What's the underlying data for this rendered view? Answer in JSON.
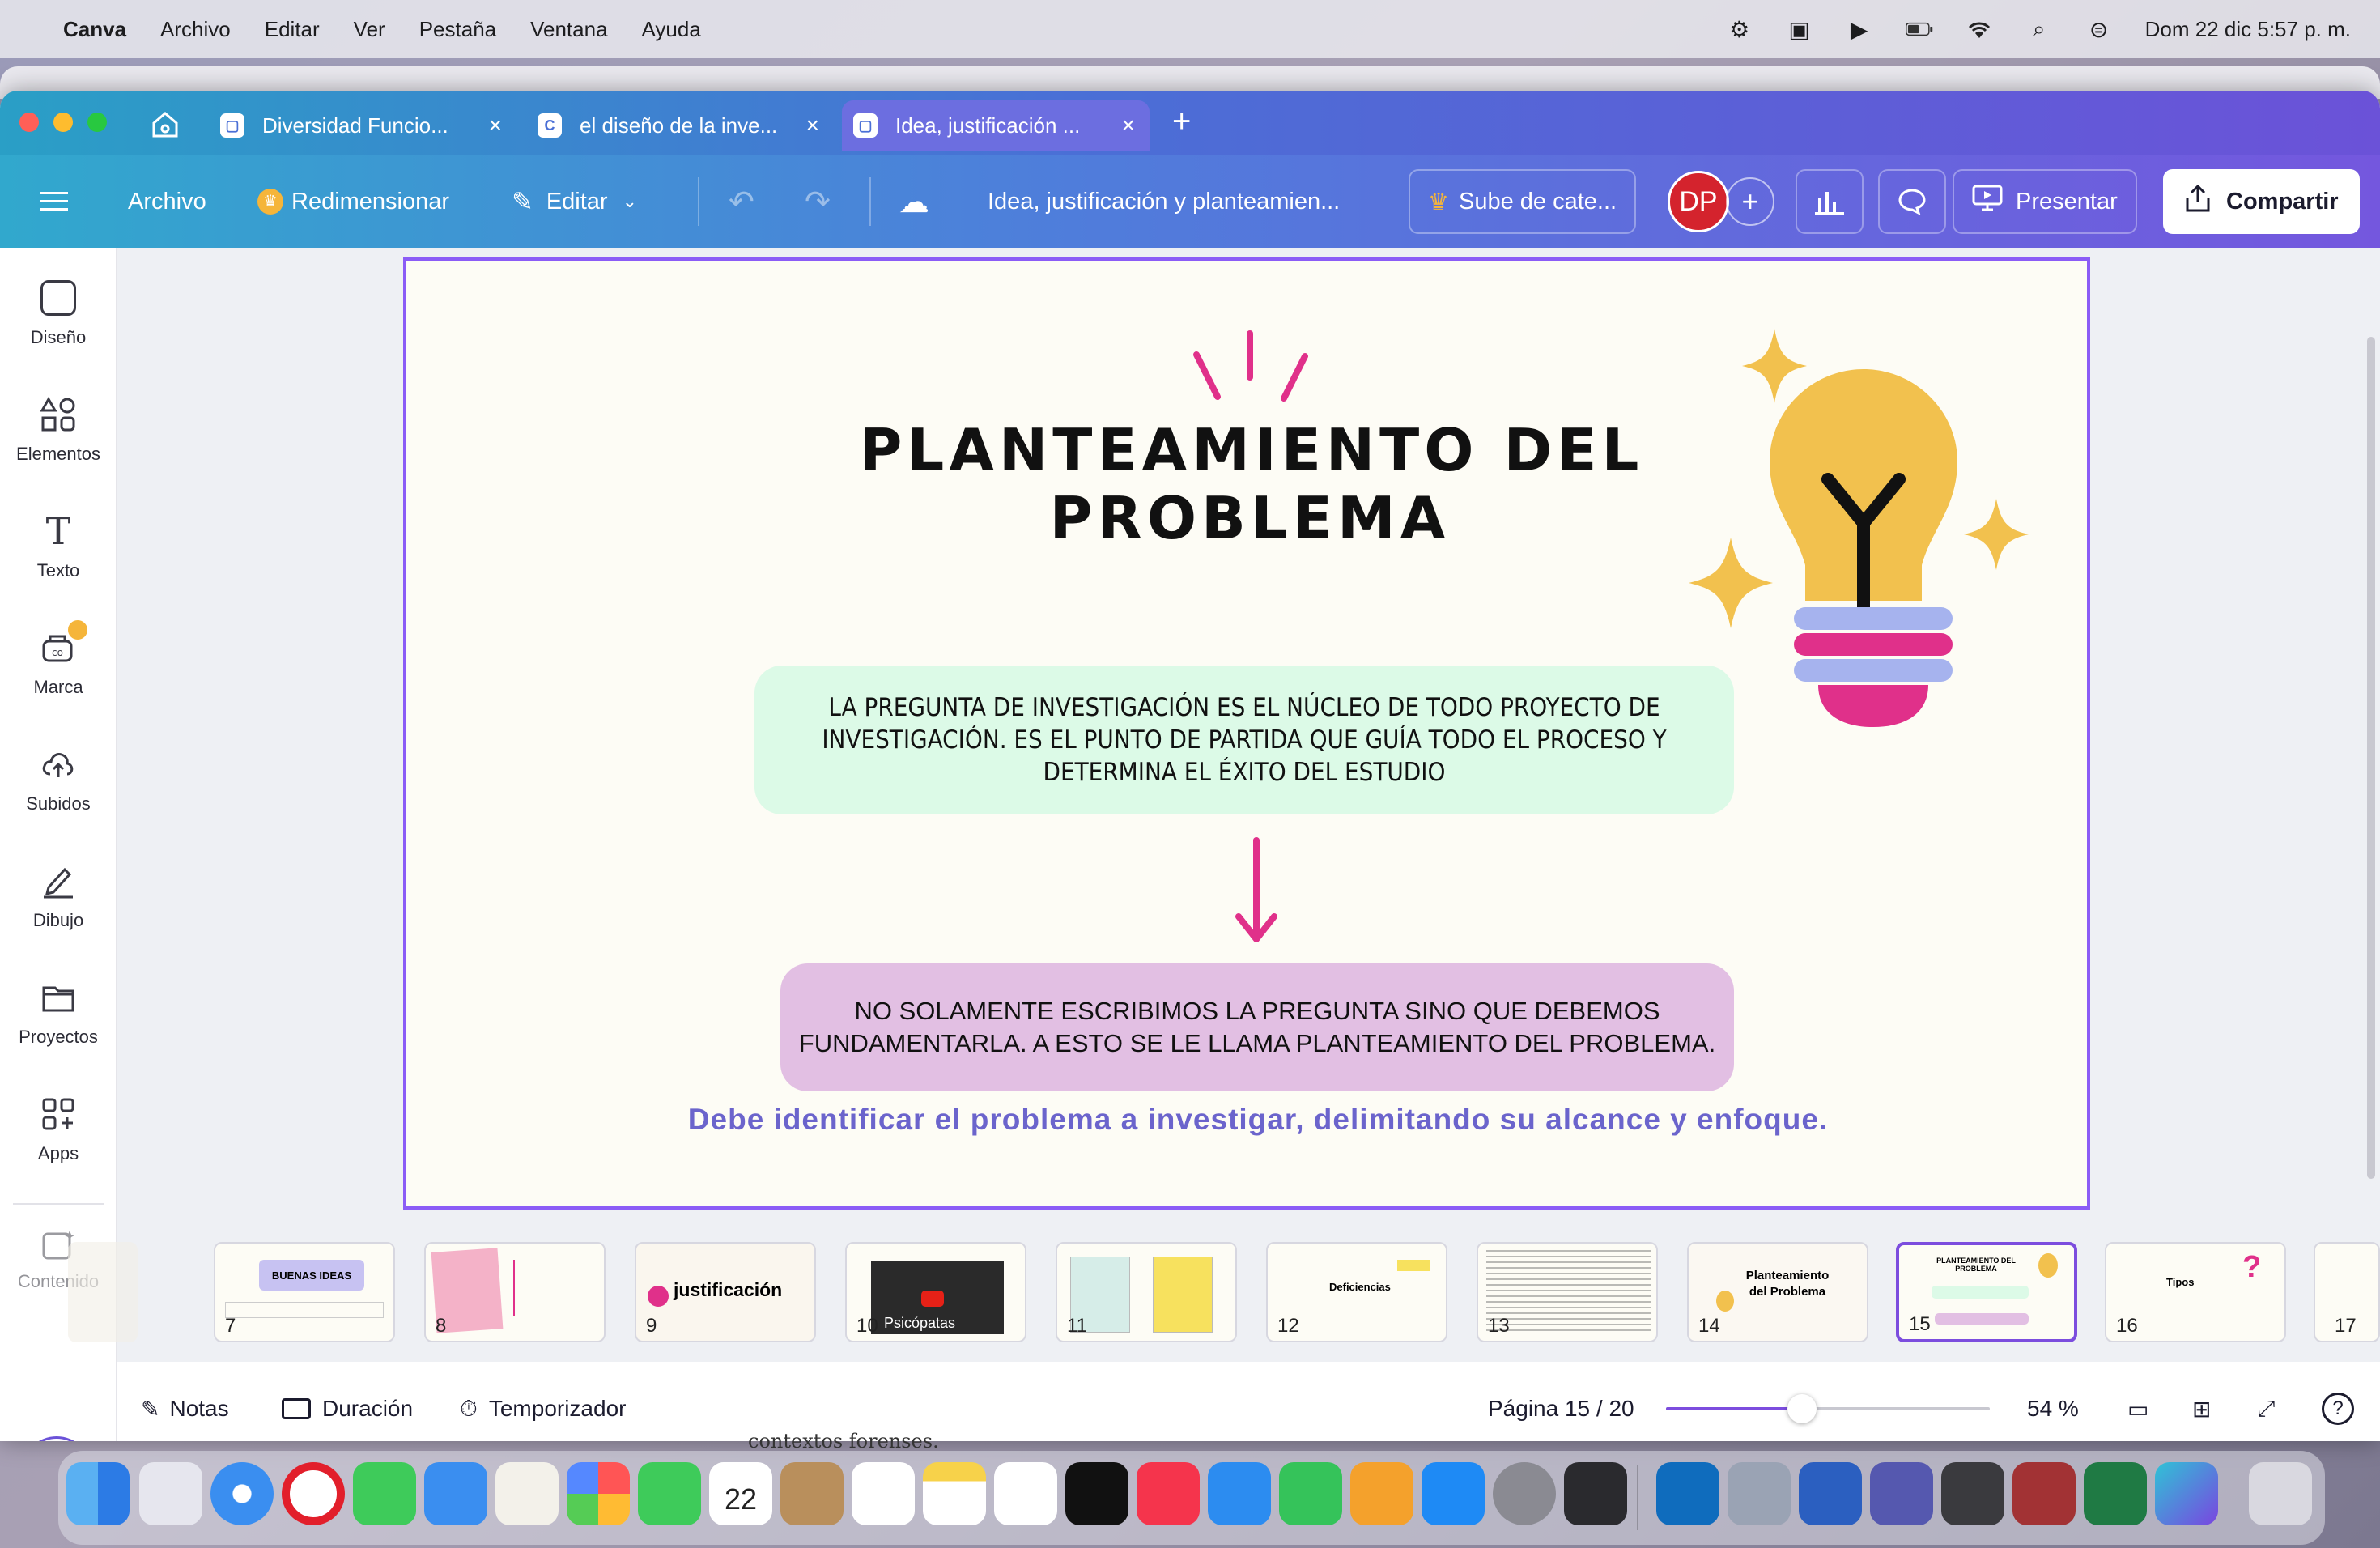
{
  "menubar": {
    "app": "Canva",
    "items": [
      "Archivo",
      "Editar",
      "Ver",
      "Pestaña",
      "Ventana",
      "Ayuda"
    ],
    "datetime": "Dom 22 dic  5:57 p. m."
  },
  "tabs": [
    {
      "label": "Diversidad Funcio..."
    },
    {
      "label": "el diseño de la inve..."
    },
    {
      "label": "Idea, justificación ..."
    }
  ],
  "toolbar": {
    "archivo": "Archivo",
    "redimensionar": "Redimensionar",
    "editar": "Editar",
    "doc_title": "Idea, justificación y planteamien...",
    "upgrade": "Sube de cate...",
    "avatar": "DP",
    "presentar": "Presentar",
    "compartir": "Compartir"
  },
  "sidebar": {
    "items": [
      {
        "label": "Diseño"
      },
      {
        "label": "Elementos"
      },
      {
        "label": "Texto"
      },
      {
        "label": "Marca"
      },
      {
        "label": "Subidos"
      },
      {
        "label": "Dibujo"
      },
      {
        "label": "Proyectos"
      },
      {
        "label": "Apps"
      },
      {
        "label": "Contenido"
      }
    ]
  },
  "slide": {
    "title_line1": "PLANTEAMIENTO DEL",
    "title_line2": "PROBLEMA",
    "box1": "LA PREGUNTA DE INVESTIGACIÓN ES EL NÚCLEO DE TODO PROYECTO DE INVESTIGACIÓN. ES EL PUNTO DE PARTIDA QUE GUÍA TODO EL PROCESO Y DETERMINA EL ÉXITO DEL ESTUDIO",
    "box2": "NO SOLAMENTE ESCRIBIMOS LA PREGUNTA SINO QUE DEBEMOS FUNDAMENTARLA. A ESTO SE LE LLAMA PLANTEAMIENTO DEL PROBLEMA.",
    "caption": "Debe identificar el problema a investigar, delimitando su alcance y enfoque."
  },
  "filmstrip": {
    "thumbs": [
      {
        "num": "7",
        "label": "BUENAS IDEAS"
      },
      {
        "num": "8",
        "label": ""
      },
      {
        "num": "9",
        "label": "justificación"
      },
      {
        "num": "10",
        "label": "Psicópatas"
      },
      {
        "num": "11",
        "label": ""
      },
      {
        "num": "12",
        "label": "Deficiencias"
      },
      {
        "num": "13",
        "label": ""
      },
      {
        "num": "14",
        "label": "Planteamiento del Problema"
      },
      {
        "num": "15",
        "label": "PLANTEAMIENTO DEL PROBLEMA"
      },
      {
        "num": "16",
        "label": "Tipos"
      },
      {
        "num": "17",
        "label": ""
      }
    ],
    "active": 15
  },
  "bottombar": {
    "notas": "Notas",
    "duracion": "Duración",
    "temporizador": "Temporizador",
    "pagina": "Página 15 / 20",
    "zoom": "54 %",
    "zoom_level": 0.42
  },
  "colors": {
    "accent": "#7c4dde",
    "pink": "#e0308a",
    "bulb": "#f2c14e",
    "lavender": "#a6b3ee",
    "mint": "#dcfae7",
    "mauve": "#e2bfe3",
    "caption": "#6b64cc"
  },
  "behind_text": "contextos forenses."
}
